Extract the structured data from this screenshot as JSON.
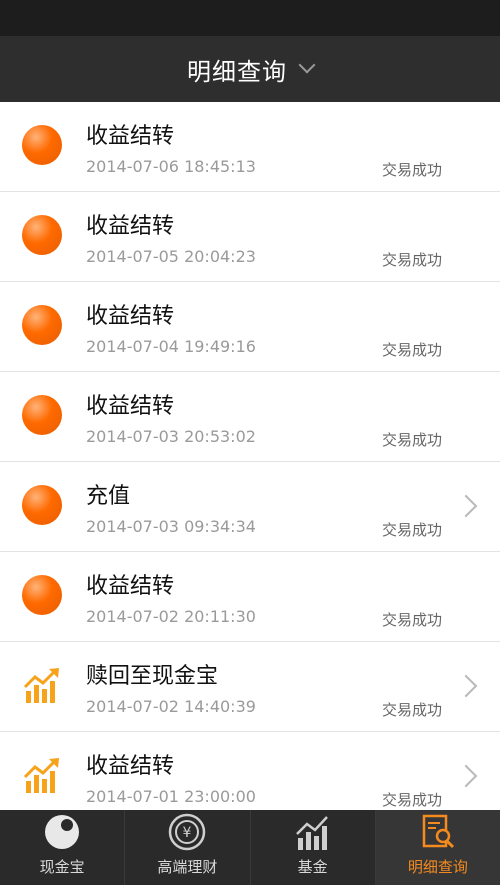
{
  "header": {
    "title": "明细查询"
  },
  "rows": [
    {
      "title": "收益结转",
      "date": "2014-07-06 18:45:13",
      "status": "交易成功",
      "icon": "orange-orb-icon"
    },
    {
      "title": "收益结转",
      "date": "2014-07-05 20:04:23",
      "status": "交易成功",
      "icon": "orange-orb-icon"
    },
    {
      "title": "收益结转",
      "date": "2014-07-04 19:49:16",
      "status": "交易成功",
      "icon": "orange-orb-icon"
    },
    {
      "title": "收益结转",
      "date": "2014-07-03 20:53:02",
      "status": "交易成功",
      "icon": "orange-orb-icon"
    },
    {
      "title": "充值",
      "date": "2014-07-03 09:34:34",
      "status": "交易成功",
      "icon": "orange-orb-icon"
    },
    {
      "title": "收益结转",
      "date": "2014-07-02 20:11:30",
      "status": "交易成功",
      "icon": "orange-orb-icon"
    },
    {
      "title": "赎回至现金宝",
      "date": "2014-07-02 14:40:39",
      "status": "交易成功",
      "icon": "chart-up-icon"
    },
    {
      "title": "收益结转",
      "date": "2014-07-01 23:00:00",
      "status": "交易成功",
      "icon": "chart-up-icon"
    }
  ],
  "tabs": [
    {
      "label": "现金宝",
      "icon": "ball-icon"
    },
    {
      "label": "高端理财",
      "icon": "yen-coin-icon"
    },
    {
      "label": "基金",
      "icon": "fund-chart-icon"
    },
    {
      "label": "明细查询",
      "icon": "detail-search-icon"
    }
  ],
  "colors": {
    "accent": "#f58a1f",
    "orb": "#ff6a00",
    "header_bg": "#2e2e2e"
  }
}
